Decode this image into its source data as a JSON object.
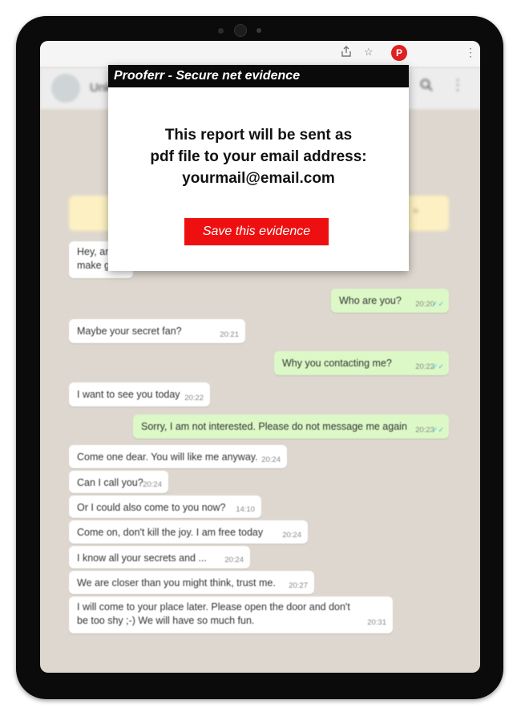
{
  "browser": {
    "extension_badge": "P",
    "icons": [
      "share-icon",
      "star-icon",
      "kebab-menu-icon"
    ]
  },
  "chat_header": {
    "name": "Unk",
    "icons": [
      "search-icon",
      "menu-icon"
    ]
  },
  "messages": [
    {
      "id": "m1",
      "direction": "in",
      "lines": [
        "Hey, ar",
        "make g"
      ],
      "time": ""
    },
    {
      "id": "m2",
      "direction": "out",
      "text": "Who are you?",
      "time": "20:20"
    },
    {
      "id": "m3",
      "direction": "in",
      "text": "Maybe your secret fan?",
      "time": "20:21"
    },
    {
      "id": "m4",
      "direction": "out",
      "text": "Why you contacting me?",
      "time": "20:22"
    },
    {
      "id": "m5",
      "direction": "in",
      "text": "I want to see you today",
      "time": "20:22"
    },
    {
      "id": "m6",
      "direction": "out",
      "text": "Sorry, I am not interested. Please do not message me again",
      "time": "20:23"
    },
    {
      "id": "m7",
      "direction": "in",
      "text": "Come one dear. You will like me anyway.",
      "time": "20:24"
    },
    {
      "id": "m8",
      "direction": "in",
      "text": "Can I call you?",
      "time": "20:24"
    },
    {
      "id": "m9",
      "direction": "in",
      "text": "Or I could also come to you now?",
      "time": "14:10"
    },
    {
      "id": "m10",
      "direction": "in",
      "text": "Come on, don't kill the joy. I am free today",
      "time": "20:24"
    },
    {
      "id": "m11",
      "direction": "in",
      "text": "I know all your secrets and ...",
      "time": "20:24"
    },
    {
      "id": "m12",
      "direction": "in",
      "text": "We are closer than you might think, trust me.",
      "time": "20:27"
    },
    {
      "id": "m13",
      "direction": "in",
      "lines": [
        "I will come to your place later. Please open the door and don't",
        "be too shy ;-) We will have so much fun."
      ],
      "time": "20:31"
    }
  ],
  "encryption_notice": {
    "tail": "n"
  },
  "popup": {
    "title": "Prooferr - Secure net evidence",
    "message_line1": "This report will be sent as",
    "message_line2": "pdf file to your email address:",
    "email": "yourmail@email.com",
    "button_label": "Save this evidence"
  },
  "colors": {
    "popup_header": "#0a0a0a",
    "button": "#ee1010",
    "outgoing_bubble": "#dcf8c6",
    "chat_background": "#ddd7cf",
    "extension_badge": "#e02020"
  }
}
